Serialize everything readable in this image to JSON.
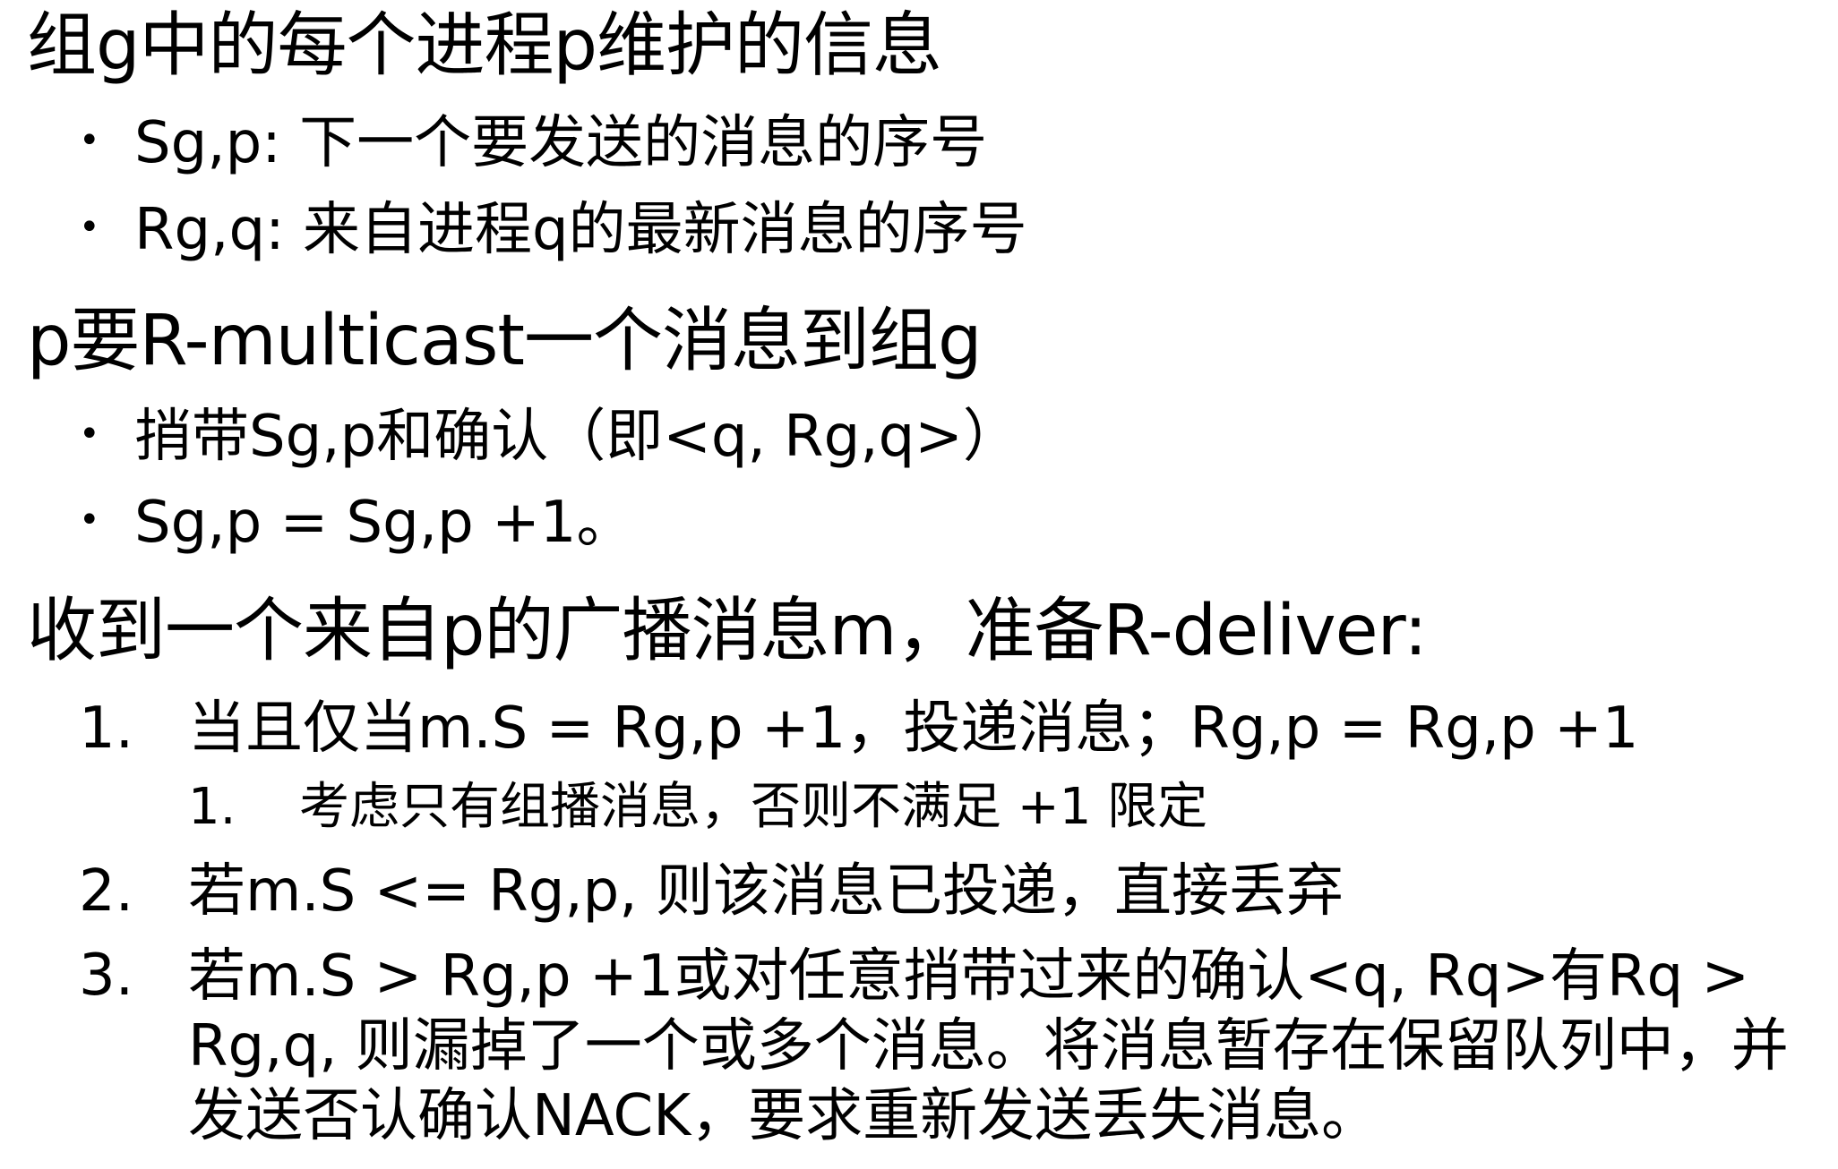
{
  "section1": {
    "heading": "组g中的每个进程p维护的信息",
    "bullets": [
      "Sg,p: 下一个要发送的消息的序号",
      "Rg,q: 来自进程q的最新消息的序号"
    ]
  },
  "section2": {
    "heading": "p要R-multicast一个消息到组g",
    "bullets": [
      "捎带Sg,p和确认（即<q, Rg,q>）",
      "Sg,p = Sg,p +1。"
    ]
  },
  "section3": {
    "heading": "收到一个来自p的广播消息m，准备R-deliver:",
    "items": [
      {
        "num": "1.",
        "text": "当且仅当m.S = Rg,p +1，投递消息；Rg,p = Rg,p +1"
      },
      {
        "num": "2.",
        "text": "若m.S <= Rg,p, 则该消息已投递，直接丢弃"
      },
      {
        "num": "3.",
        "text": "若m.S > Rg,p +1或对任意捎带过来的确认<q, Rq>有Rq > Rg,q, 则漏掉了一个或多个消息。将消息暂存在保留队列中，并发送否认确认NACK，要求重新发送丢失消息。"
      }
    ],
    "subitem": {
      "num": "1.",
      "text": "考虑只有组播消息，否则不满足 +1 限定"
    }
  },
  "bullet_symbol": "•"
}
